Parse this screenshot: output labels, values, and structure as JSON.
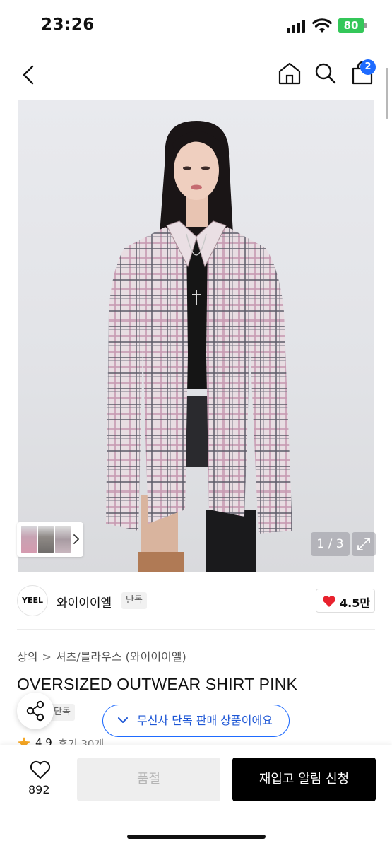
{
  "status_bar": {
    "time": "23:26",
    "battery": "80",
    "battery_color": "#34c759"
  },
  "header": {
    "back_icon": "chevron-left-icon",
    "home_icon": "home-icon",
    "search_icon": "search-icon",
    "cart_icon": "shopping-bag-icon",
    "cart_count": "2",
    "badge_color": "#1e6bff"
  },
  "gallery": {
    "counter": "1 / 3",
    "expand_icon": "expand-icon",
    "thumbnails_arrow_icon": "chevron-right-icon"
  },
  "brand": {
    "logo_text": "YEEL",
    "name": "와이이이엘",
    "tag": "단독",
    "likes": "4.5만",
    "heart_color": "#e8222e"
  },
  "breadcrumb": {
    "category": "상의",
    "subcategory": "셔츠/블라우스 (와이이이엘)"
  },
  "product": {
    "title": "OVERSIZED OUTWEAR SHIRT PINK",
    "exclusive_tag": "단독",
    "exclusive_notice": "무신사 단독 판매 상품이에요",
    "rating": "4.9",
    "reviews": "후기 30개"
  },
  "bottom_bar": {
    "wish_count": "892",
    "soldout_label": "품절",
    "restock_label": "재입고 알림 신청"
  }
}
